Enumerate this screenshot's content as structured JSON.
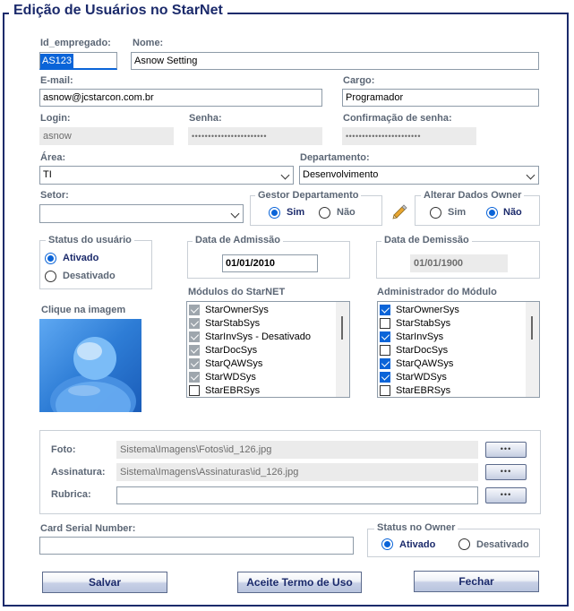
{
  "window": {
    "title": "Edição de Usuários no StarNet"
  },
  "fields": {
    "id_empregado": {
      "label": "Id_empregado:",
      "value": "AS123"
    },
    "nome": {
      "label": "Nome:",
      "value": "Asnow Setting"
    },
    "email": {
      "label": "E-mail:",
      "value": "asnow@jcstarcon.com.br"
    },
    "cargo": {
      "label": "Cargo:",
      "value": "Programador"
    },
    "login": {
      "label": "Login:",
      "value": "asnow"
    },
    "senha": {
      "label": "Senha:",
      "value": "•••••••••••••••••••••••"
    },
    "confirmacao": {
      "label": "Confirmação de senha:",
      "value": "•••••••••••••••••••••••"
    },
    "area": {
      "label": "Área:",
      "value": "TI"
    },
    "departamento": {
      "label": "Departamento:",
      "value": "Desenvolvimento"
    },
    "setor": {
      "label": "Setor:",
      "value": ""
    }
  },
  "gestor": {
    "title": "Gestor Departamento",
    "options": [
      "Sim",
      "Não"
    ],
    "selected": "Sim"
  },
  "owner": {
    "title": "Alterar Dados Owner",
    "options": [
      "Sim",
      "Não"
    ],
    "selected": "Não"
  },
  "status_usuario": {
    "title": "Status do usuário",
    "options": [
      "Ativado",
      "Desativado"
    ],
    "selected": "Ativado"
  },
  "admissao": {
    "title": "Data de Admissão",
    "value": "01/01/2010"
  },
  "demissao": {
    "title": "Data de Demissão",
    "value": "01/01/1900"
  },
  "photo": {
    "label": "Clique na imagem"
  },
  "modulos": {
    "title": "Módulos do StarNET",
    "items": [
      {
        "label": "StarOwnerSys",
        "checked": true,
        "disabled": true
      },
      {
        "label": "StarStabSys",
        "checked": true,
        "disabled": true
      },
      {
        "label": "StarInvSys - Desativado",
        "checked": true,
        "disabled": true
      },
      {
        "label": "StarDocSys",
        "checked": true,
        "disabled": true
      },
      {
        "label": "StarQAWSys",
        "checked": true,
        "disabled": true
      },
      {
        "label": "StarWDSys",
        "checked": true,
        "disabled": true
      },
      {
        "label": "StarEBRSys",
        "checked": false,
        "disabled": false
      }
    ]
  },
  "administrador": {
    "title": "Administrador do Módulo",
    "items": [
      {
        "label": "StarOwnerSys",
        "checked": true
      },
      {
        "label": "StarStabSys",
        "checked": false
      },
      {
        "label": "StarInvSys",
        "checked": true
      },
      {
        "label": "StarDocSys",
        "checked": false
      },
      {
        "label": "StarQAWSys",
        "checked": true
      },
      {
        "label": "StarWDSys",
        "checked": true
      },
      {
        "label": "StarEBRSys",
        "checked": false
      }
    ]
  },
  "arquivos": {
    "foto": {
      "label": "Foto:",
      "value": "Sistema\\Imagens\\Fotos\\id_126.jpg"
    },
    "assinatura": {
      "label": "Assinatura:",
      "value": "Sistema\\Imagens\\Assinaturas\\id_126.jpg"
    },
    "rubrica": {
      "label": "Rubrica:",
      "value": ""
    },
    "browse_label": "•••"
  },
  "card_serial": {
    "label": "Card Serial Number:",
    "value": ""
  },
  "status_owner": {
    "title": "Status no Owner",
    "options": [
      "Ativado",
      "Desativado"
    ],
    "selected": "Ativado"
  },
  "buttons": {
    "salvar": "Salvar",
    "aceite": "Aceite Termo de Uso",
    "fechar": "Fechar"
  },
  "colors": {
    "accent": "#0a64d8",
    "title": "#1b2a6b",
    "label": "#5b6675"
  }
}
